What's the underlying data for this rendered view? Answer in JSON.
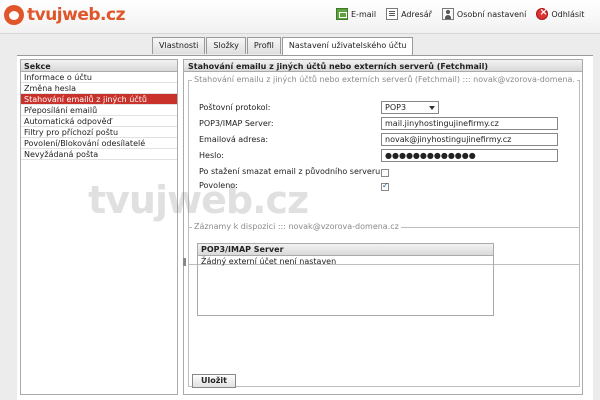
{
  "brand": {
    "logo_text": "tvujweb.cz",
    "watermark": "tvujweb.cz",
    "color": "#e0562a"
  },
  "toplinks": [
    {
      "label": "E-mail",
      "icon": "email-icon"
    },
    {
      "label": "Adresář",
      "icon": "address-book-icon"
    },
    {
      "label": "Osobní nastavení",
      "icon": "personal-settings-icon"
    },
    {
      "label": "Odhlásit",
      "icon": "logout-icon"
    }
  ],
  "tabs": [
    {
      "label": "Vlastnosti"
    },
    {
      "label": "Složky"
    },
    {
      "label": "Profil"
    },
    {
      "label": "Nastavení uživatelského účtu",
      "active": true
    }
  ],
  "sidebar": {
    "title": "Sekce",
    "items": [
      {
        "label": "Informace o účtu"
      },
      {
        "label": "Změna hesla"
      },
      {
        "label": "Stahování emailů z jiných účtů",
        "active": true
      },
      {
        "label": "Přeposílání emailů"
      },
      {
        "label": "Automatická odpověď"
      },
      {
        "label": "Filtry pro příchozí poštu"
      },
      {
        "label": "Povolení/Blokování odesílatelé"
      },
      {
        "label": "Nevyžádaná pošta"
      }
    ]
  },
  "main": {
    "title": "Stahování emailu z jiných účtů nebo externích serverů (Fetchmail)",
    "form": {
      "legend": "Stahování emailu z jiných účtů nebo externích serverů (Fetchmail) ::: novak@vzorova-domena.",
      "protocol_label": "Poštovní protokol:",
      "protocol_value": "POP3",
      "server_label": "POP3/IMAP Server:",
      "server_value": "mail.jinyhostingujinefirmy.cz",
      "email_label": "Emailová adresa:",
      "email_value": "novak@jinyhostingujinefirmy.cz",
      "password_label": "Heslo:",
      "password_value": "●●●●●●●●●●●●●",
      "delete_label": "Po stažení smazat email z původního serveru:",
      "delete_checked": false,
      "enabled_label": "Povoleno:",
      "enabled_checked": true
    },
    "records": {
      "legend": "Záznamy k dispozici ::: novak@vzorova-domena.cz",
      "column": "POP3/IMAP Server",
      "empty_row": "Žádný externí účet není nastaven"
    },
    "save_label": "Uložit"
  },
  "colors": {
    "active": "#c8322b"
  }
}
